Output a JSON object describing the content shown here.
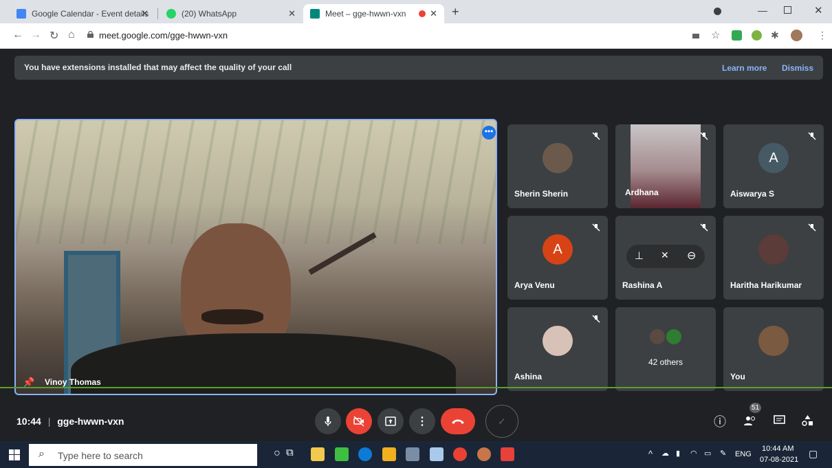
{
  "browser": {
    "tabs": [
      {
        "label": "Google Calendar - Event details",
        "favicon_color": "#4285f4",
        "favicon_text": "7"
      },
      {
        "label": "(20) WhatsApp",
        "favicon_color": "#25d366",
        "favicon_text": "20"
      },
      {
        "label": "Meet – gge-hwwn-vxn",
        "favicon_color": "#00897b",
        "favicon_text": ""
      }
    ],
    "url": "meet.google.com/gge-hwwn-vxn"
  },
  "banner": {
    "message": "You have extensions installed that may affect the quality of your call",
    "learn_more": "Learn more",
    "dismiss": "Dismiss"
  },
  "main_video": {
    "name": "Vinoy Thomas"
  },
  "participants": [
    {
      "name": "Sherin Sherin",
      "avatar_type": "photo",
      "avatar_color": "#6b5a4c"
    },
    {
      "name": "Ardhana",
      "avatar_type": "video",
      "avatar_color": "#9b7f86"
    },
    {
      "name": "Aiswarya S",
      "avatar_type": "letter",
      "letter": "A",
      "avatar_color": "#455a64"
    },
    {
      "name": "Arya Venu",
      "avatar_type": "letter",
      "letter": "A",
      "avatar_color": "#d84315"
    },
    {
      "name": "Rashina A",
      "avatar_type": "hover",
      "avatar_color": "#3c4043"
    },
    {
      "name": "Haritha Harikumar",
      "avatar_type": "photo",
      "avatar_color": "#5b3c38"
    },
    {
      "name": "Ashina",
      "avatar_type": "photo",
      "avatar_color": "#d8c2b8"
    },
    {
      "name": "42 others",
      "avatar_type": "group",
      "avatar_color": "#4f6c4e"
    },
    {
      "name": "You",
      "avatar_type": "photo",
      "avatar_color": "#7a5a40"
    }
  ],
  "bottom_bar": {
    "time": "10:44",
    "meeting_code": "gge-hwwn-vxn",
    "participant_count": "51"
  },
  "taskbar": {
    "search_placeholder": "Type here to search",
    "language": "ENG",
    "time": "10:44 AM",
    "date": "07-08-2021"
  },
  "colors": {
    "end_call": "#ea4335",
    "accent": "#8ab4f8"
  }
}
